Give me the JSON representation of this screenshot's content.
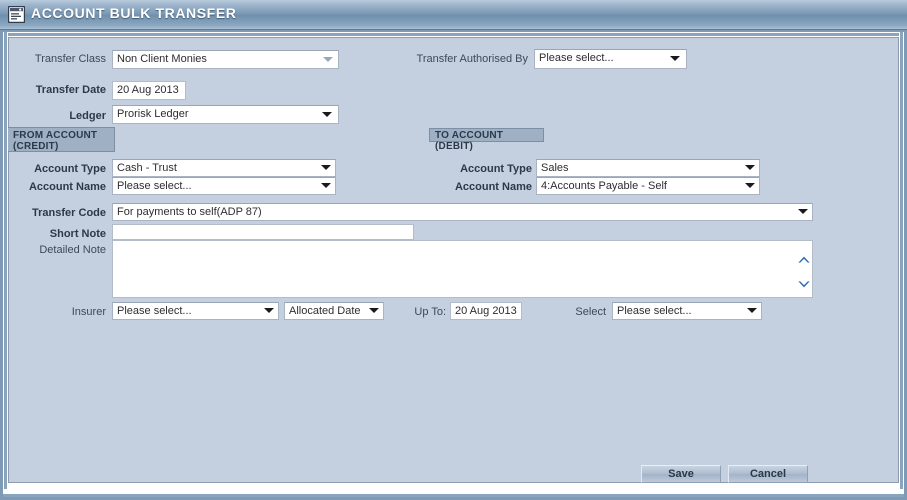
{
  "window": {
    "title": "ACCOUNT BULK TRANSFER",
    "icon": "document-window-icon",
    "accent_color": "#7b98b4",
    "panel_color": "#c4cfdf"
  },
  "form": {
    "transfer_class": {
      "label": "Transfer Class",
      "value": "Non Client Monies",
      "control": "dropdown"
    },
    "transfer_authorised_by": {
      "label": "Transfer Authorised By",
      "value": "Please select...",
      "control": "dropdown"
    },
    "transfer_date": {
      "label": "Transfer Date",
      "value": "20 Aug 2013",
      "control": "text"
    },
    "ledger": {
      "label": "Ledger",
      "value": "Prorisk Ledger",
      "control": "dropdown"
    },
    "transfer_code": {
      "label": "Transfer Code",
      "value": "For payments to self(ADP 87)",
      "control": "dropdown"
    },
    "short_note": {
      "label": "Short Note",
      "value": "",
      "placeholder": "",
      "control": "text"
    },
    "detailed_note": {
      "label": "Detailed Note",
      "value": "",
      "placeholder": "",
      "control": "textarea",
      "scroll_up_icon": "chevron-up-icon",
      "scroll_down_icon": "chevron-down-icon",
      "scroll_icon_color": "#2d6ab5"
    }
  },
  "from_account": {
    "header_line1": "FROM ACCOUNT",
    "header_line2": "(CREDIT)",
    "account_type": {
      "label": "Account Type",
      "value": "Cash - Trust",
      "control": "dropdown"
    },
    "account_name": {
      "label": "Account Name",
      "value": "Please select...",
      "control": "dropdown"
    }
  },
  "to_account": {
    "header": "TO ACCOUNT (DEBIT)",
    "account_type": {
      "label": "Account Type",
      "value": "Sales",
      "control": "dropdown"
    },
    "account_name": {
      "label": "Account Name",
      "value": "4:Accounts Payable - Self",
      "control": "dropdown"
    }
  },
  "filters": {
    "insurer": {
      "label": "Insurer",
      "value": "Please select...",
      "control": "dropdown"
    },
    "date_type": {
      "label": "",
      "value": "Allocated Date",
      "control": "dropdown"
    },
    "up_to": {
      "label": "Up To:",
      "value": "20 Aug 2013",
      "control": "text"
    },
    "select": {
      "label": "Select",
      "value": "Please select...",
      "control": "dropdown"
    }
  },
  "actions": {
    "save_label": "Save",
    "cancel_label": "Cancel"
  }
}
